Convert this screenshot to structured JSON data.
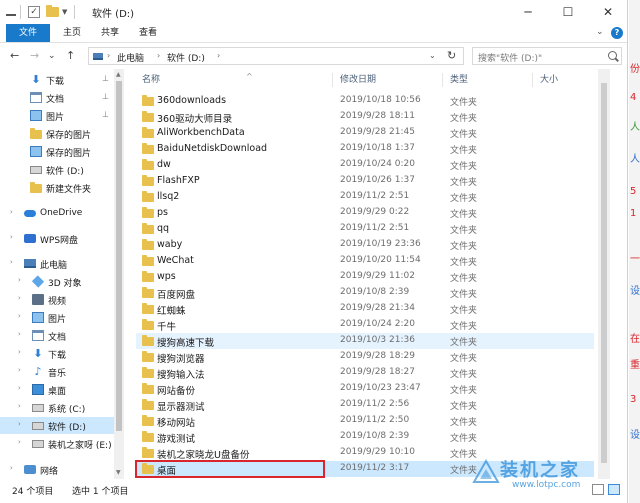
{
  "window": {
    "title": "软件 (D:)",
    "minimize_glyph": "─",
    "maximize_glyph": "☐",
    "close_glyph": "✕"
  },
  "ribbon": {
    "tabs": [
      "文件",
      "主页",
      "共享",
      "查看"
    ],
    "expand_glyph": "⌄",
    "help_glyph": "?"
  },
  "address": {
    "back_glyph": "←",
    "forward_glyph": "→",
    "recent_glyph": "⌄",
    "up_glyph": "↑",
    "path": [
      "此电脑",
      "软件 (D:)"
    ],
    "separator": "›",
    "dropdown_glyph": "⌄",
    "refresh_glyph": "↻",
    "search_placeholder": "搜索\"软件 (D:)\""
  },
  "sidebar": {
    "items": [
      {
        "label": "下载",
        "icon": "download-icon",
        "pinned": true
      },
      {
        "label": "文档",
        "icon": "document-icon",
        "pinned": true
      },
      {
        "label": "图片",
        "icon": "picture-icon",
        "pinned": true
      },
      {
        "label": "保存的图片",
        "icon": "folder-icon",
        "pinned": false
      },
      {
        "label": "保存的图片",
        "icon": "picture-icon",
        "pinned": false
      },
      {
        "label": "软件 (D:)",
        "icon": "drive-icon",
        "pinned": false
      },
      {
        "label": "新建文件夹",
        "icon": "folder-icon",
        "pinned": false
      },
      {
        "label": "OneDrive",
        "icon": "onedrive-icon",
        "pinned": false
      },
      {
        "label": "WPS网盘",
        "icon": "wps-icon",
        "pinned": false
      },
      {
        "label": "此电脑",
        "icon": "computer-icon",
        "pinned": false
      },
      {
        "label": "3D 对象",
        "icon": "3d-objects-icon",
        "pinned": false
      },
      {
        "label": "视频",
        "icon": "video-icon",
        "pinned": false
      },
      {
        "label": "图片",
        "icon": "picture-icon",
        "pinned": false
      },
      {
        "label": "文档",
        "icon": "document-icon",
        "pinned": false
      },
      {
        "label": "下载",
        "icon": "download-icon",
        "pinned": false
      },
      {
        "label": "音乐",
        "icon": "music-icon",
        "pinned": false
      },
      {
        "label": "桌面",
        "icon": "desktop-icon",
        "pinned": false
      },
      {
        "label": "系统 (C:)",
        "icon": "drive-icon",
        "pinned": false
      },
      {
        "label": "软件 (D:)",
        "icon": "drive-icon",
        "pinned": false
      },
      {
        "label": "装机之家呀 (E:)",
        "icon": "drive-icon",
        "pinned": false
      },
      {
        "label": "网络",
        "icon": "network-icon",
        "pinned": false
      }
    ],
    "pin_glyph": "📌",
    "chevron_glyph": "›"
  },
  "columns": {
    "name": "名称",
    "date": "修改日期",
    "type": "类型",
    "size": "大小",
    "sort_glyph": "^"
  },
  "files": [
    {
      "name": "360downloads",
      "date": "2019/10/18 10:56",
      "type": "文件夹"
    },
    {
      "name": "360驱动大师目录",
      "date": "2019/9/28 18:11",
      "type": "文件夹"
    },
    {
      "name": "AliWorkbenchData",
      "date": "2019/9/28 21:45",
      "type": "文件夹"
    },
    {
      "name": "BaiduNetdiskDownload",
      "date": "2019/10/18 1:37",
      "type": "文件夹"
    },
    {
      "name": "dw",
      "date": "2019/10/24 0:20",
      "type": "文件夹"
    },
    {
      "name": "FlashFXP",
      "date": "2019/10/26 1:37",
      "type": "文件夹"
    },
    {
      "name": "llsq2",
      "date": "2019/11/2 2:51",
      "type": "文件夹"
    },
    {
      "name": "ps",
      "date": "2019/9/29 0:22",
      "type": "文件夹"
    },
    {
      "name": "qq",
      "date": "2019/11/2 2:51",
      "type": "文件夹"
    },
    {
      "name": "waby",
      "date": "2019/10/19 23:36",
      "type": "文件夹"
    },
    {
      "name": "WeChat",
      "date": "2019/10/20 11:54",
      "type": "文件夹"
    },
    {
      "name": "wps",
      "date": "2019/9/29 11:02",
      "type": "文件夹"
    },
    {
      "name": "百度网盘",
      "date": "2019/10/8 2:39",
      "type": "文件夹"
    },
    {
      "name": "红蜘蛛",
      "date": "2019/9/28 21:34",
      "type": "文件夹"
    },
    {
      "name": "千牛",
      "date": "2019/10/24 2:20",
      "type": "文件夹"
    },
    {
      "name": "搜狗高速下载",
      "date": "2019/10/3 21:36",
      "type": "文件夹"
    },
    {
      "name": "搜狗浏览器",
      "date": "2019/9/28 18:29",
      "type": "文件夹"
    },
    {
      "name": "搜狗输入法",
      "date": "2019/9/28 18:27",
      "type": "文件夹"
    },
    {
      "name": "网站备份",
      "date": "2019/10/23 23:47",
      "type": "文件夹"
    },
    {
      "name": "显示器测试",
      "date": "2019/11/2 2:56",
      "type": "文件夹"
    },
    {
      "name": "移动网站",
      "date": "2019/11/2 2:50",
      "type": "文件夹"
    },
    {
      "name": "游戏测试",
      "date": "2019/10/8 2:39",
      "type": "文件夹"
    },
    {
      "name": "装机之家晓龙U盘备份",
      "date": "2019/9/29 10:10",
      "type": "文件夹"
    },
    {
      "name": "桌面",
      "date": "2019/11/2 3:17",
      "type": "文件夹"
    }
  ],
  "status": {
    "count": "24 个项目",
    "selection": "选中 1 个项目"
  },
  "watermark": {
    "text": "装机之家",
    "url": "www.lotpc.com"
  },
  "edge_chars": [
    "份",
    "4",
    "人",
    "人",
    "5",
    "1",
    "一",
    "设",
    "在",
    "重",
    "3",
    "设"
  ],
  "colors": {
    "accent": "#1979ca",
    "selection": "#cce8ff",
    "hover": "#e5f3ff",
    "folder": "#e8c04e",
    "highlight_box": "#d9262c"
  }
}
